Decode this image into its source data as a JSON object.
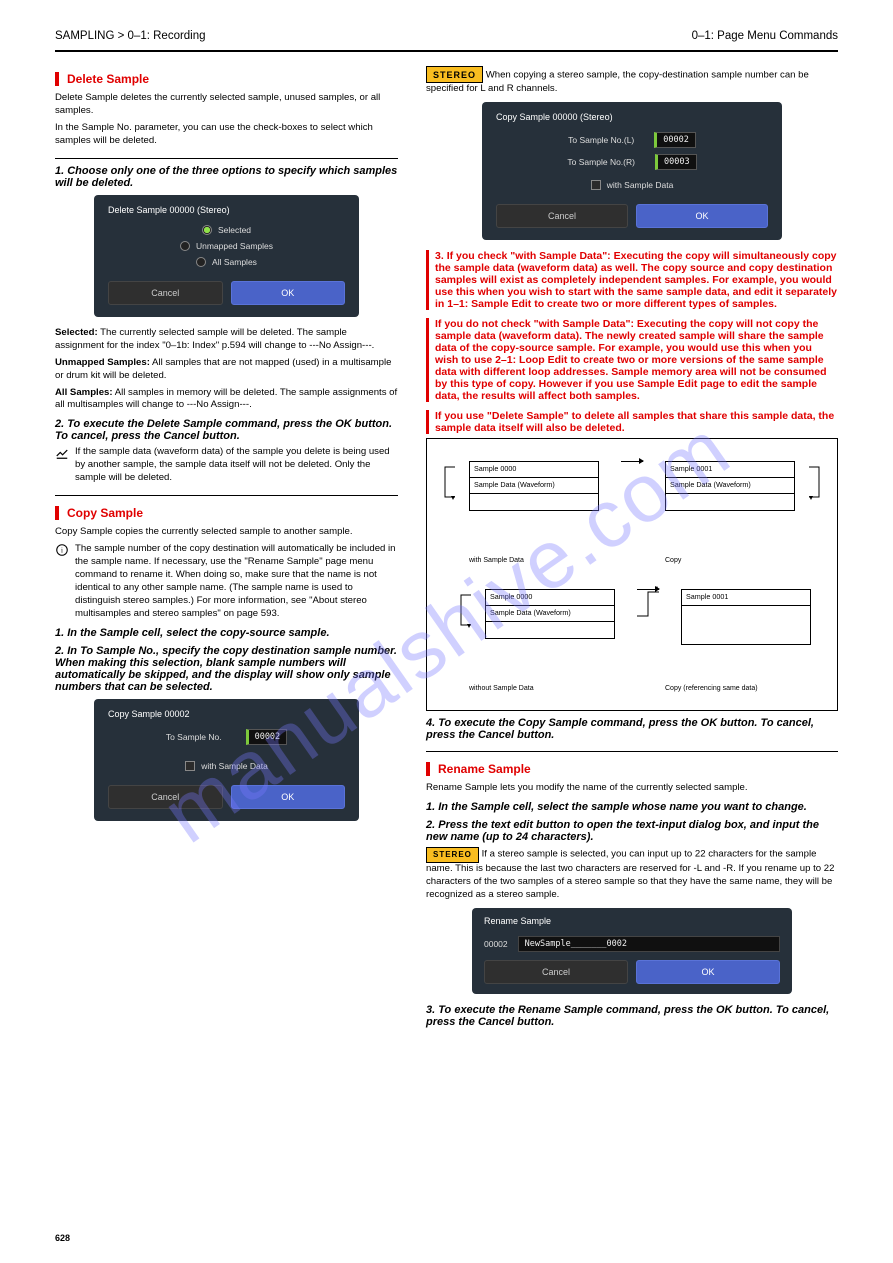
{
  "header": {
    "left": "SAMPLING > 0–1: Recording",
    "right": "0–1: Page Menu Commands"
  },
  "left_col": {
    "h1": "Delete Sample",
    "p1a": "Delete Sample deletes the currently selected sample, unused samples, or all samples.",
    "p1b": "In the Sample No. parameter, you can use the check-boxes to select which samples will be deleted.",
    "dlg1": {
      "title": "Delete Sample 00000 (Stereo)",
      "opt1": "Selected",
      "opt2": "Unmapped Samples",
      "opt3": "All Samples",
      "cancel": "Cancel",
      "ok": "OK"
    },
    "lbl_sel": "Selected:",
    "p_sel": "The currently selected sample will be deleted. The sample assignment for the index \"0–1b: Index\" p.594 will change to ---No Assign---.",
    "lbl_unmap": "Unmapped Samples:",
    "p_unmap": "All samples that are not mapped (used) in a multisample or drum kit will be deleted.",
    "lbl_all": "All Samples:",
    "p_all": "All samples in memory will be deleted. The sample assignments of all multisamples will change to ---No Assign---.",
    "p_ok": "To execute the Delete Sample command, press the OK button. To cancel, press the Cancel button.",
    "note1": "If the sample data (waveform data) of the sample you delete is being used by another sample, the sample data itself will not be deleted. Only the sample will be deleted.",
    "h2": "Copy Sample",
    "p_cs1": "Copy Sample copies the currently selected sample to another sample.",
    "note2": "The sample number of the copy destination will automatically be included in the sample name. If necessary, use the \"Rename Sample\" page menu command to rename it. When doing so, make sure that the name is not identical to any other sample name. (The sample name is used to distinguish stereo samples.) For more information, see \"About stereo multisamples and stereo samples\" on page 593.",
    "p_cs2": "In the Sample cell, select the copy-source sample.",
    "p_cs3": "In To Sample No., specify the copy destination sample number. When making this selection, blank sample numbers will automatically be skipped, and the display will show only sample numbers that can be selected.",
    "dlg2": {
      "title": "Copy Sample 00002",
      "to": "To Sample No.",
      "val": "00002",
      "with": "with Sample Data",
      "cancel": "Cancel",
      "ok": "OK"
    }
  },
  "right_col": {
    "stereo_lbl": "STEREO",
    "p_stereo": "When copying a stereo sample, the copy-destination sample number can be specified for L and R channels.",
    "dlg3": {
      "title": "Copy Sample 00000 (Stereo)",
      "toL": "To Sample No.(L)",
      "toR": "To Sample No.(R)",
      "valL": "00002",
      "valR": "00003",
      "with": "with Sample Data",
      "cancel": "Cancel",
      "ok": "OK"
    },
    "p_with1": "If you check \"with Sample Data\": Executing the copy will simultaneously copy the sample data (waveform data) as well. The copy source and copy destination samples will exist as completely independent samples. For example, you would use this when you wish to start with the same sample data, and edit it separately in 1–1: Sample Edit to create two or more different types of samples.",
    "p_with2": "If you do not check \"with Sample Data\": Executing the copy will not copy the sample data (waveform data). The newly created sample will share the sample data of the copy-source sample. For example, you would use this when you wish to use 2–1: Loop Edit to create two or more versions of the same sample data with different loop addresses. Sample memory area will not be consumed by this type of copy. However if you use Sample Edit page to edit the sample data, the results will affect both samples.",
    "p_with3": "If you use \"Delete Sample\" to delete all samples that share this sample data, the sample data itself will also be deleted.",
    "diagram": {
      "row1": {
        "left_title": "Sample 0000",
        "shared_data": "Sample Data (Waveform)",
        "right_title": "Sample 0001",
        "label_l": "with Sample Data",
        "label_r": "Copy"
      },
      "row2": {
        "left_title": "Sample 0000",
        "shared_data": "Sample Data (Waveform)",
        "right_title": "Sample 0001",
        "label_l": "without Sample Data",
        "label_r": "Copy (referencing same data)"
      }
    },
    "p_exec": "To execute the Copy Sample command, press the OK button. To cancel, press the Cancel button.",
    "h3": "Rename Sample",
    "p_r1": "Rename Sample lets you modify the name of the currently selected sample.",
    "p_r2": "In the Sample cell, select the sample whose name you want to change.",
    "p_r3": "Press the text edit button to open the text-input dialog box, and input the new name (up to 24 characters).",
    "p_stereo2": "If a stereo sample is selected, you can input up to 22 characters for the sample name. This is because the last two characters are reserved for -L and -R. If you rename up to 22 characters of the two samples of a stereo sample so that they have the same name, they will be recognized as a stereo sample.",
    "dlg4": {
      "title": "Rename Sample",
      "num": "00002",
      "val": "NewSample_______0002",
      "cancel": "Cancel",
      "ok": "OK"
    },
    "p_r_ok": "To execute the Rename Sample command, press the OK button. To cancel, press the Cancel button."
  },
  "footer": {
    "page": "628"
  }
}
